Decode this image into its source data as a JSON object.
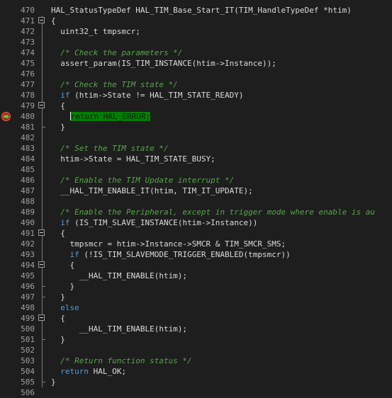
{
  "editor": {
    "current_line_number": "480",
    "lines": [
      {
        "num": "470",
        "fold": "none",
        "code": [
          {
            "t": "HAL_StatusTypeDef HAL_TIM_Base_Start_IT(TIM_HandleTypeDef *htim)",
            "c": "id"
          }
        ]
      },
      {
        "num": "471",
        "fold": "box",
        "code": [
          {
            "t": "{",
            "c": "op"
          }
        ]
      },
      {
        "num": "472",
        "fold": "line",
        "code": [
          {
            "t": "  uint32_t tmpsmcr;",
            "c": "id"
          }
        ]
      },
      {
        "num": "473",
        "fold": "line",
        "code": []
      },
      {
        "num": "474",
        "fold": "line",
        "code": [
          {
            "t": "  /* Check the parameters */",
            "c": "comment"
          }
        ]
      },
      {
        "num": "475",
        "fold": "line",
        "code": [
          {
            "t": "  assert_param(IS_TIM_INSTANCE(htim->Instance));",
            "c": "id"
          }
        ]
      },
      {
        "num": "476",
        "fold": "line",
        "code": []
      },
      {
        "num": "477",
        "fold": "line",
        "code": [
          {
            "t": "  /* Check the TIM state */",
            "c": "comment"
          }
        ]
      },
      {
        "num": "478",
        "fold": "line",
        "code": [
          {
            "t": "  ",
            "c": "id"
          },
          {
            "t": "if",
            "c": "kw"
          },
          {
            "t": " (htim->State != HAL_TIM_STATE_READY)",
            "c": "id"
          }
        ]
      },
      {
        "num": "479",
        "fold": "box",
        "code": [
          {
            "t": "  {",
            "c": "op"
          }
        ]
      },
      {
        "num": "480",
        "fold": "line",
        "breakpoint": true,
        "current": true,
        "code": [
          {
            "t": "    ",
            "c": "id"
          },
          {
            "t": "cursor",
            "c": "cursor"
          },
          {
            "t": "return HAL_ERROR;",
            "c": "hl"
          }
        ]
      },
      {
        "num": "481",
        "fold": "end",
        "code": [
          {
            "t": "  }",
            "c": "op"
          }
        ]
      },
      {
        "num": "482",
        "fold": "line",
        "code": []
      },
      {
        "num": "483",
        "fold": "line",
        "code": [
          {
            "t": "  /* Set the TIM state */",
            "c": "comment"
          }
        ]
      },
      {
        "num": "484",
        "fold": "line",
        "code": [
          {
            "t": "  htim->State = HAL_TIM_STATE_BUSY;",
            "c": "id"
          }
        ]
      },
      {
        "num": "485",
        "fold": "line",
        "code": []
      },
      {
        "num": "486",
        "fold": "line",
        "code": [
          {
            "t": "  /* Enable the TIM Update interrupt */",
            "c": "comment"
          }
        ]
      },
      {
        "num": "487",
        "fold": "line",
        "code": [
          {
            "t": "  __HAL_TIM_ENABLE_IT(htim, TIM_IT_UPDATE);",
            "c": "id"
          }
        ]
      },
      {
        "num": "488",
        "fold": "line",
        "code": []
      },
      {
        "num": "489",
        "fold": "line",
        "code": [
          {
            "t": "  /* Enable the Peripheral, except in trigger mode where enable is au",
            "c": "comment"
          }
        ]
      },
      {
        "num": "490",
        "fold": "line",
        "code": [
          {
            "t": "  ",
            "c": "id"
          },
          {
            "t": "if",
            "c": "kw"
          },
          {
            "t": " (IS_TIM_SLAVE_INSTANCE(htim->Instance))",
            "c": "id"
          }
        ]
      },
      {
        "num": "491",
        "fold": "box",
        "code": [
          {
            "t": "  {",
            "c": "op"
          }
        ]
      },
      {
        "num": "492",
        "fold": "line",
        "code": [
          {
            "t": "    tmpsmcr = htim->Instance->SMCR & TIM_SMCR_SMS;",
            "c": "id"
          }
        ]
      },
      {
        "num": "493",
        "fold": "line",
        "code": [
          {
            "t": "    ",
            "c": "id"
          },
          {
            "t": "if",
            "c": "kw"
          },
          {
            "t": " (!IS_TIM_SLAVEMODE_TRIGGER_ENABLED(tmpsmcr))",
            "c": "id"
          }
        ]
      },
      {
        "num": "494",
        "fold": "box",
        "code": [
          {
            "t": "    {",
            "c": "op"
          }
        ]
      },
      {
        "num": "495",
        "fold": "line",
        "code": [
          {
            "t": "      __HAL_TIM_ENABLE(htim);",
            "c": "id"
          }
        ]
      },
      {
        "num": "496",
        "fold": "end",
        "code": [
          {
            "t": "    }",
            "c": "op"
          }
        ]
      },
      {
        "num": "497",
        "fold": "end",
        "code": [
          {
            "t": "  }",
            "c": "op"
          }
        ]
      },
      {
        "num": "498",
        "fold": "line",
        "code": [
          {
            "t": "  ",
            "c": "id"
          },
          {
            "t": "else",
            "c": "kw"
          }
        ]
      },
      {
        "num": "499",
        "fold": "box",
        "code": [
          {
            "t": "  {",
            "c": "op"
          }
        ]
      },
      {
        "num": "500",
        "fold": "line",
        "code": [
          {
            "t": "      __HAL_TIM_ENABLE(htim);",
            "c": "id"
          }
        ]
      },
      {
        "num": "501",
        "fold": "end",
        "code": [
          {
            "t": "  }",
            "c": "op"
          }
        ]
      },
      {
        "num": "502",
        "fold": "line",
        "code": []
      },
      {
        "num": "503",
        "fold": "line",
        "code": [
          {
            "t": "  /* Return function status */",
            "c": "comment"
          }
        ]
      },
      {
        "num": "504",
        "fold": "line",
        "code": [
          {
            "t": "  ",
            "c": "id"
          },
          {
            "t": "return",
            "c": "kw"
          },
          {
            "t": " HAL_OK;",
            "c": "id"
          }
        ]
      },
      {
        "num": "505",
        "fold": "end",
        "code": [
          {
            "t": "}",
            "c": "op"
          }
        ]
      },
      {
        "num": "506",
        "fold": "none",
        "code": []
      }
    ]
  },
  "colors": {
    "background": "#1e1e1e",
    "line_number": "#a0a0a0",
    "keyword": "#569cd6",
    "comment": "#57a64a",
    "identifier": "#dcdcdc",
    "current_line_highlight": "#008000",
    "breakpoint": "#c21a1a",
    "execution_arrow": "#4bd33b"
  },
  "icons": {
    "breakpoint": "breakpoint-icon",
    "execution_arrow": "execution-pointer-icon",
    "fold_collapse": "fold-collapse-icon"
  }
}
